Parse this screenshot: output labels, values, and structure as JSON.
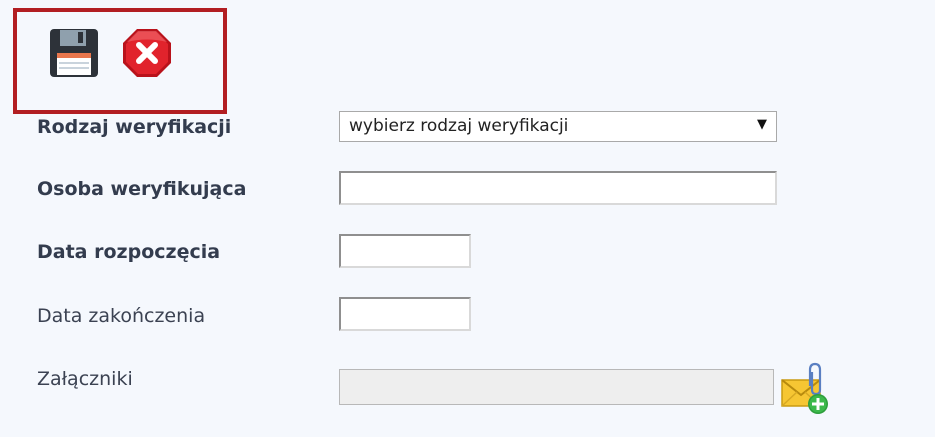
{
  "toolbar": {
    "save_icon": "floppy-disk-icon",
    "cancel_icon": "stop-x-icon",
    "highlight_color": "#b21e22"
  },
  "form": {
    "verification_type": {
      "label": "Rodzaj weryfikacji",
      "selected": "wybierz rodzaj weryfikacji"
    },
    "verifier": {
      "label": "Osoba weryfikująca",
      "value": ""
    },
    "start_date": {
      "label": "Data rozpoczęcia",
      "value": ""
    },
    "end_date": {
      "label": "Data zakończenia",
      "value": ""
    },
    "attachments": {
      "label": "Załączniki",
      "value": "",
      "add_icon": "attach-envelope-add-icon"
    }
  }
}
